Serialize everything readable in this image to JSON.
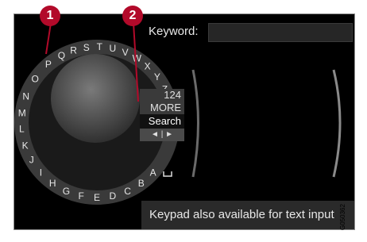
{
  "keyword": {
    "label": "Keyword:",
    "value": ""
  },
  "wheel_letters": [
    "R",
    "S",
    "T",
    "U",
    "V",
    "W",
    "X",
    "Y",
    "Z",
    "Q",
    "P",
    "O",
    "N",
    "M",
    "L",
    "K",
    "J",
    "I",
    "H",
    "G",
    "F",
    "E",
    "D",
    "C",
    "B",
    "A"
  ],
  "menu": {
    "number": "124",
    "more": "MORE",
    "search": "Search",
    "arrows": "◄ | ►"
  },
  "bottom_text": "Keypad also available for text input",
  "callouts": {
    "one": "1",
    "two": "2"
  },
  "image_code": "G050362",
  "colors": {
    "callout": "#b20a2a",
    "screen_bg": "#000000"
  }
}
